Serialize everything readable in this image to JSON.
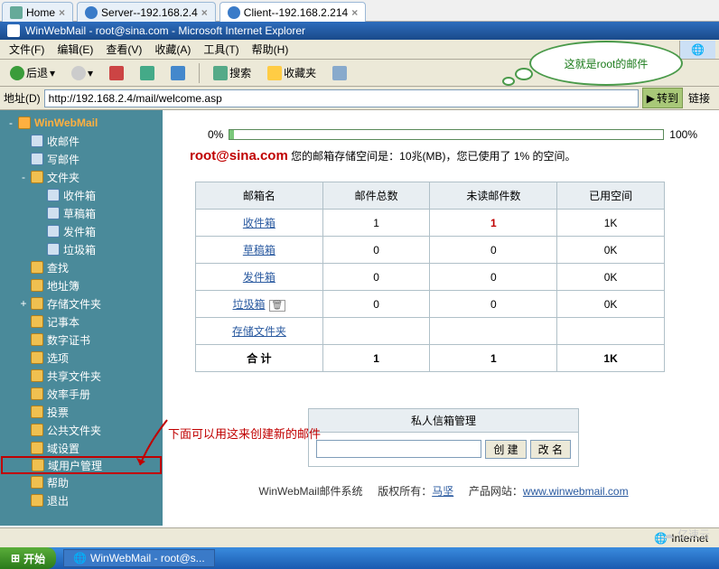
{
  "tabs": [
    {
      "icon": "home",
      "label": "Home"
    },
    {
      "icon": "globe",
      "label": "Server--192.168.2.4"
    },
    {
      "icon": "globe",
      "label": "Client--192.168.2.214",
      "active": true
    }
  ],
  "window_title": "WinWebMail - root@sina.com - Microsoft Internet Explorer",
  "menus": [
    "文件(F)",
    "编辑(E)",
    "查看(V)",
    "收藏(A)",
    "工具(T)",
    "帮助(H)"
  ],
  "toolbar": {
    "back": "后退",
    "search": "搜索",
    "fav": "收藏夹"
  },
  "address": {
    "label": "地址(D)",
    "url": "http://192.168.2.4/mail/welcome.asp",
    "go": "转到",
    "links": "链接"
  },
  "sidebar": {
    "root": "WinWebMail",
    "items": [
      {
        "label": "收邮件",
        "lvl": 1,
        "ico": "mail"
      },
      {
        "label": "写邮件",
        "lvl": 1,
        "ico": "mail"
      },
      {
        "label": "文件夹",
        "lvl": 1,
        "exp": "-",
        "ico": "fold"
      },
      {
        "label": "收件箱",
        "lvl": 2,
        "ico": "mail"
      },
      {
        "label": "草稿箱",
        "lvl": 2,
        "ico": "mail"
      },
      {
        "label": "发件箱",
        "lvl": 2,
        "ico": "mail"
      },
      {
        "label": "垃圾箱",
        "lvl": 2,
        "ico": "mail"
      },
      {
        "label": "查找",
        "lvl": 1,
        "ico": "fold"
      },
      {
        "label": "地址簿",
        "lvl": 1,
        "ico": "fold"
      },
      {
        "label": "存储文件夹",
        "lvl": 1,
        "exp": "+",
        "ico": "fold"
      },
      {
        "label": "记事本",
        "lvl": 1,
        "ico": "fold"
      },
      {
        "label": "数字证书",
        "lvl": 1,
        "ico": "fold"
      },
      {
        "label": "选项",
        "lvl": 1,
        "ico": "fold"
      },
      {
        "label": "共享文件夹",
        "lvl": 1,
        "ico": "fold"
      },
      {
        "label": "效率手册",
        "lvl": 1,
        "ico": "fold"
      },
      {
        "label": "投票",
        "lvl": 1,
        "ico": "fold"
      },
      {
        "label": "公共文件夹",
        "lvl": 1,
        "ico": "fold"
      },
      {
        "label": "域设置",
        "lvl": 1,
        "ico": "fold"
      },
      {
        "label": "域用户管理",
        "lvl": 1,
        "ico": "fold",
        "hl": true
      },
      {
        "label": "帮助",
        "lvl": 1,
        "ico": "fold"
      },
      {
        "label": "退出",
        "lvl": 1,
        "ico": "fold"
      }
    ]
  },
  "quota": {
    "pct_left": "0%",
    "pct_right": "100%",
    "used_pct": 1,
    "email": "root@sina.com",
    "text": "您的邮箱存储空间是：10兆(MB)，您已使用了 1% 的空间。"
  },
  "table": {
    "headers": [
      "邮箱名",
      "邮件总数",
      "未读邮件数",
      "已用空间"
    ],
    "rows": [
      {
        "name": "收件箱",
        "total": "1",
        "unread": "1",
        "unread_red": true,
        "space": "1K"
      },
      {
        "name": "草稿箱",
        "total": "0",
        "unread": "0",
        "space": "0K"
      },
      {
        "name": "发件箱",
        "total": "0",
        "unread": "0",
        "space": "0K"
      },
      {
        "name": "垃圾箱",
        "trash": true,
        "total": "0",
        "unread": "0",
        "space": "0K"
      },
      {
        "name": "存储文件夹",
        "total": "",
        "unread": "",
        "space": ""
      }
    ],
    "sum": {
      "label": "合 计",
      "total": "1",
      "unread": "1",
      "space": "1K"
    }
  },
  "pbox": {
    "title": "私人信箱管理",
    "create": "创 建",
    "rename": "改 名"
  },
  "footer": {
    "sys": "WinWebMail邮件系统",
    "copy": "版权所有：",
    "author": "马坚",
    "site_label": "产品网站：",
    "site": "www.winwebmail.com"
  },
  "annotations": {
    "bubble": "这就是root的邮件",
    "below": "下面可以用这来创建新的邮件"
  },
  "status": {
    "net": "Internet"
  },
  "taskbar": {
    "start": "开始",
    "task": "WinWebMail - root@s..."
  },
  "watermark": "亿速云"
}
